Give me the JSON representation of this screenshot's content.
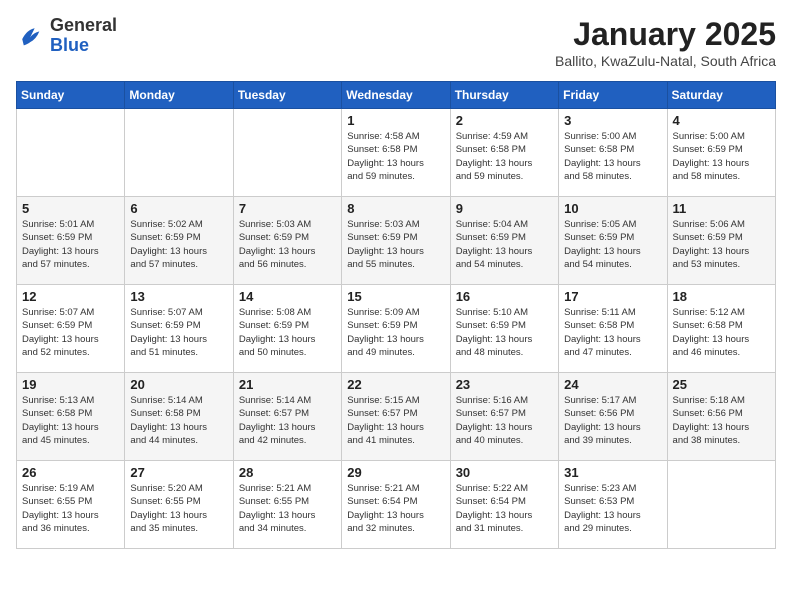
{
  "header": {
    "logo": {
      "general": "General",
      "blue": "Blue"
    },
    "title": "January 2025",
    "location": "Ballito, KwaZulu-Natal, South Africa"
  },
  "calendar": {
    "weekdays": [
      "Sunday",
      "Monday",
      "Tuesday",
      "Wednesday",
      "Thursday",
      "Friday",
      "Saturday"
    ],
    "weeks": [
      [
        {
          "day": "",
          "info": ""
        },
        {
          "day": "",
          "info": ""
        },
        {
          "day": "",
          "info": ""
        },
        {
          "day": "1",
          "info": "Sunrise: 4:58 AM\nSunset: 6:58 PM\nDaylight: 13 hours\nand 59 minutes."
        },
        {
          "day": "2",
          "info": "Sunrise: 4:59 AM\nSunset: 6:58 PM\nDaylight: 13 hours\nand 59 minutes."
        },
        {
          "day": "3",
          "info": "Sunrise: 5:00 AM\nSunset: 6:58 PM\nDaylight: 13 hours\nand 58 minutes."
        },
        {
          "day": "4",
          "info": "Sunrise: 5:00 AM\nSunset: 6:59 PM\nDaylight: 13 hours\nand 58 minutes."
        }
      ],
      [
        {
          "day": "5",
          "info": "Sunrise: 5:01 AM\nSunset: 6:59 PM\nDaylight: 13 hours\nand 57 minutes."
        },
        {
          "day": "6",
          "info": "Sunrise: 5:02 AM\nSunset: 6:59 PM\nDaylight: 13 hours\nand 57 minutes."
        },
        {
          "day": "7",
          "info": "Sunrise: 5:03 AM\nSunset: 6:59 PM\nDaylight: 13 hours\nand 56 minutes."
        },
        {
          "day": "8",
          "info": "Sunrise: 5:03 AM\nSunset: 6:59 PM\nDaylight: 13 hours\nand 55 minutes."
        },
        {
          "day": "9",
          "info": "Sunrise: 5:04 AM\nSunset: 6:59 PM\nDaylight: 13 hours\nand 54 minutes."
        },
        {
          "day": "10",
          "info": "Sunrise: 5:05 AM\nSunset: 6:59 PM\nDaylight: 13 hours\nand 54 minutes."
        },
        {
          "day": "11",
          "info": "Sunrise: 5:06 AM\nSunset: 6:59 PM\nDaylight: 13 hours\nand 53 minutes."
        }
      ],
      [
        {
          "day": "12",
          "info": "Sunrise: 5:07 AM\nSunset: 6:59 PM\nDaylight: 13 hours\nand 52 minutes."
        },
        {
          "day": "13",
          "info": "Sunrise: 5:07 AM\nSunset: 6:59 PM\nDaylight: 13 hours\nand 51 minutes."
        },
        {
          "day": "14",
          "info": "Sunrise: 5:08 AM\nSunset: 6:59 PM\nDaylight: 13 hours\nand 50 minutes."
        },
        {
          "day": "15",
          "info": "Sunrise: 5:09 AM\nSunset: 6:59 PM\nDaylight: 13 hours\nand 49 minutes."
        },
        {
          "day": "16",
          "info": "Sunrise: 5:10 AM\nSunset: 6:59 PM\nDaylight: 13 hours\nand 48 minutes."
        },
        {
          "day": "17",
          "info": "Sunrise: 5:11 AM\nSunset: 6:58 PM\nDaylight: 13 hours\nand 47 minutes."
        },
        {
          "day": "18",
          "info": "Sunrise: 5:12 AM\nSunset: 6:58 PM\nDaylight: 13 hours\nand 46 minutes."
        }
      ],
      [
        {
          "day": "19",
          "info": "Sunrise: 5:13 AM\nSunset: 6:58 PM\nDaylight: 13 hours\nand 45 minutes."
        },
        {
          "day": "20",
          "info": "Sunrise: 5:14 AM\nSunset: 6:58 PM\nDaylight: 13 hours\nand 44 minutes."
        },
        {
          "day": "21",
          "info": "Sunrise: 5:14 AM\nSunset: 6:57 PM\nDaylight: 13 hours\nand 42 minutes."
        },
        {
          "day": "22",
          "info": "Sunrise: 5:15 AM\nSunset: 6:57 PM\nDaylight: 13 hours\nand 41 minutes."
        },
        {
          "day": "23",
          "info": "Sunrise: 5:16 AM\nSunset: 6:57 PM\nDaylight: 13 hours\nand 40 minutes."
        },
        {
          "day": "24",
          "info": "Sunrise: 5:17 AM\nSunset: 6:56 PM\nDaylight: 13 hours\nand 39 minutes."
        },
        {
          "day": "25",
          "info": "Sunrise: 5:18 AM\nSunset: 6:56 PM\nDaylight: 13 hours\nand 38 minutes."
        }
      ],
      [
        {
          "day": "26",
          "info": "Sunrise: 5:19 AM\nSunset: 6:55 PM\nDaylight: 13 hours\nand 36 minutes."
        },
        {
          "day": "27",
          "info": "Sunrise: 5:20 AM\nSunset: 6:55 PM\nDaylight: 13 hours\nand 35 minutes."
        },
        {
          "day": "28",
          "info": "Sunrise: 5:21 AM\nSunset: 6:55 PM\nDaylight: 13 hours\nand 34 minutes."
        },
        {
          "day": "29",
          "info": "Sunrise: 5:21 AM\nSunset: 6:54 PM\nDaylight: 13 hours\nand 32 minutes."
        },
        {
          "day": "30",
          "info": "Sunrise: 5:22 AM\nSunset: 6:54 PM\nDaylight: 13 hours\nand 31 minutes."
        },
        {
          "day": "31",
          "info": "Sunrise: 5:23 AM\nSunset: 6:53 PM\nDaylight: 13 hours\nand 29 minutes."
        },
        {
          "day": "",
          "info": ""
        }
      ]
    ]
  }
}
